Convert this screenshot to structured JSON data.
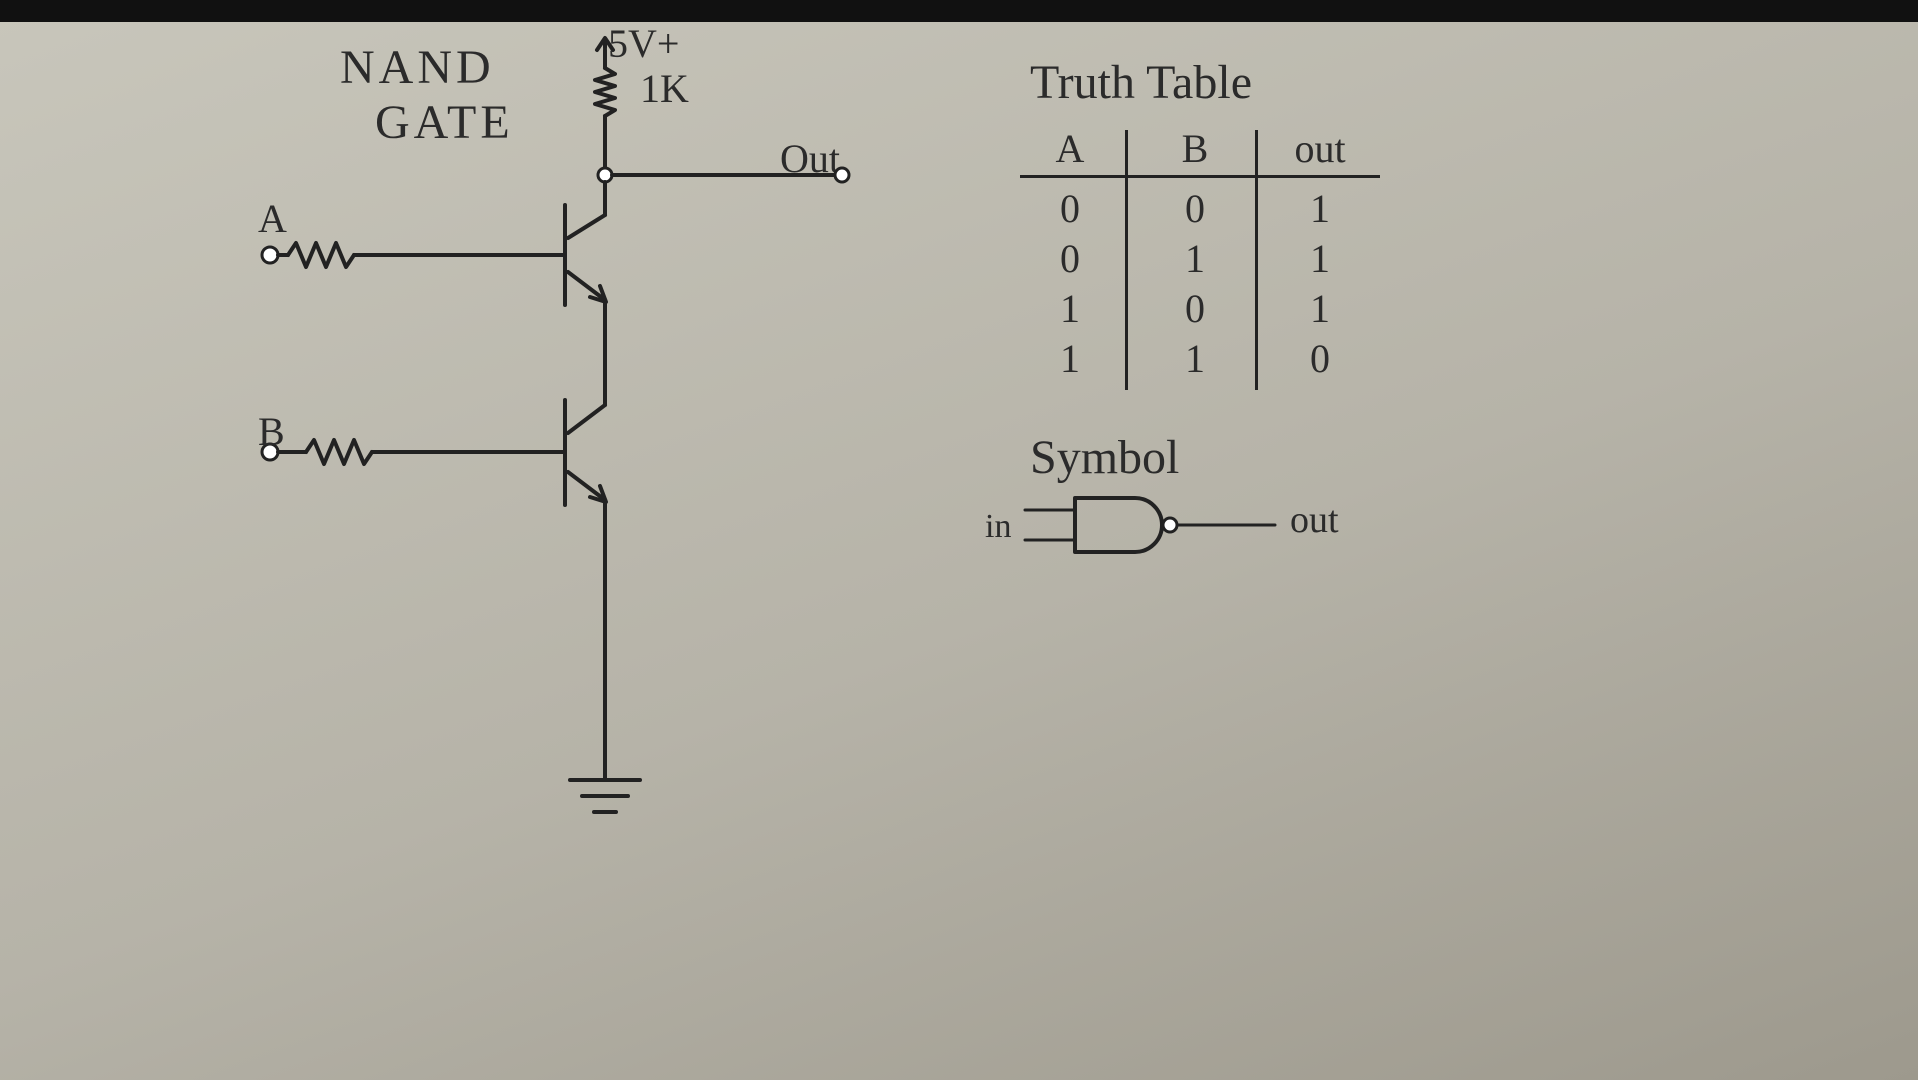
{
  "title_line1": "NAND",
  "title_line2": "GATE",
  "supply_label": "5V+",
  "supply_res": "1K",
  "out_label": "Out",
  "input_a": "A",
  "input_b": "B",
  "truth_table": {
    "heading": "Truth Table",
    "cols": [
      "A",
      "B",
      "out"
    ],
    "rows": [
      [
        "0",
        "0",
        "1"
      ],
      [
        "0",
        "1",
        "1"
      ],
      [
        "1",
        "0",
        "1"
      ],
      [
        "1",
        "1",
        "0"
      ]
    ]
  },
  "symbol": {
    "heading": "Symbol",
    "in_label": "in",
    "out_label": "out"
  },
  "chart_data": {
    "type": "table",
    "title": "NAND Gate Truth Table",
    "columns": [
      "A",
      "B",
      "out"
    ],
    "rows": [
      [
        0,
        0,
        1
      ],
      [
        0,
        1,
        1
      ],
      [
        1,
        0,
        1
      ],
      [
        1,
        1,
        0
      ]
    ]
  }
}
